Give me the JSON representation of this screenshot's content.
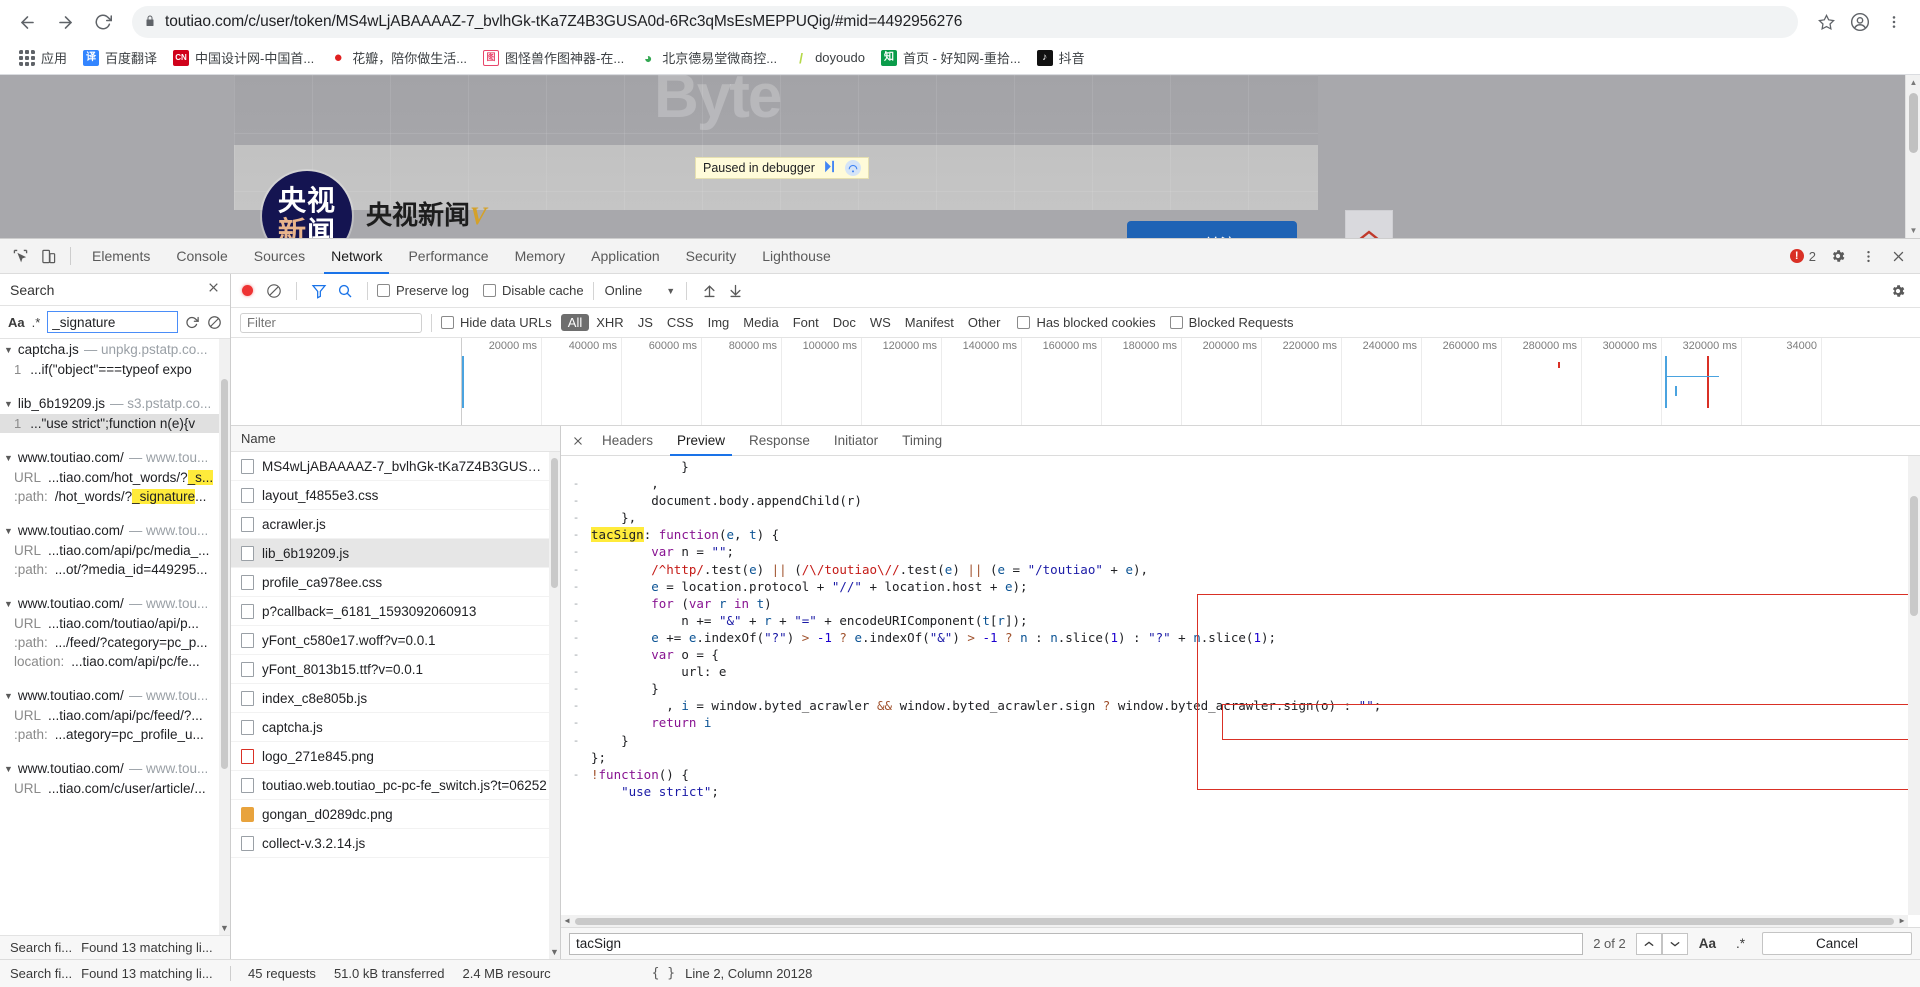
{
  "browser": {
    "url": "toutiao.com/c/user/token/MS4wLjABAAAAZ-7_bvlhGk-tKa7Z4B3GUSA0d-6Rc3qMsEsMEPPUQig/#mid=4492956276",
    "back_icon": "back-arrow-icon",
    "forward_icon": "forward-arrow-icon",
    "reload_icon": "reload-icon",
    "lock_icon": "lock-icon",
    "star_icon": "star-icon",
    "profile_icon": "profile-avatar-icon",
    "menu_icon": "three-dot-menu-icon",
    "bookmarks": [
      {
        "label": "应用",
        "icon": "apps-grid-icon",
        "color": "#4285f4",
        "glyph": ""
      },
      {
        "label": "百度翻译",
        "icon": "baidu-translate-icon",
        "color": "#3385ff",
        "glyph": "译"
      },
      {
        "label": "中国设计网-中国首...",
        "icon": "cnd-icon",
        "color": "#d0021b",
        "glyph": "CN"
      },
      {
        "label": "花瓣，陪你做生活...",
        "icon": "huaban-icon",
        "color": "#e02020",
        "glyph": "●"
      },
      {
        "label": "图怪兽作图神器-在...",
        "icon": "tuguaishou-icon",
        "color": "#e8466b",
        "glyph": "图"
      },
      {
        "label": "北京德易堂微商控...",
        "icon": "deyitang-icon",
        "color": "#34a853",
        "glyph": "◎"
      },
      {
        "label": "doyoudo",
        "icon": "doyoudo-icon",
        "color": "#c9e265",
        "glyph": "/"
      },
      {
        "label": "首页 - 好知网-重拾...",
        "icon": "haozhi-icon",
        "color": "#0a9c4a",
        "glyph": "知"
      },
      {
        "label": "抖音",
        "icon": "douyin-icon",
        "color": "#111111",
        "glyph": "♪"
      }
    ]
  },
  "page": {
    "watermark": "Byte",
    "avatar_line1": "央视",
    "avatar_line2_a": "新",
    "avatar_line2_b": "闻",
    "account_name": "央视新闻",
    "account_badge": "V",
    "follow_label": "＋关注",
    "scroll_top_icon": "chevron-up-icon",
    "paused_banner": {
      "text": "Paused in debugger",
      "resume_icon": "resume-script-icon",
      "step_icon": "step-over-icon"
    }
  },
  "devtools": {
    "inspect_icon": "inspect-element-icon",
    "device_icon": "device-toolbar-icon",
    "tabs": [
      {
        "label": "Elements",
        "active": false
      },
      {
        "label": "Console",
        "active": false
      },
      {
        "label": "Sources",
        "active": false
      },
      {
        "label": "Network",
        "active": true
      },
      {
        "label": "Performance",
        "active": false
      },
      {
        "label": "Memory",
        "active": false
      },
      {
        "label": "Application",
        "active": false
      },
      {
        "label": "Security",
        "active": false
      },
      {
        "label": "Lighthouse",
        "active": false
      }
    ],
    "error_count": "2",
    "settings_icon": "gear-icon",
    "more_icon": "three-dot-menu-icon",
    "close_icon": "close-icon",
    "customize_icon": "customize-settings-icon"
  },
  "search_panel": {
    "title": "Search",
    "close_icon": "close-icon",
    "match_case_label": "Aa",
    "regex_label": ".*",
    "query": "_signature",
    "refresh_icon": "refresh-icon",
    "clear_icon": "clear-icon",
    "footer_label": "Search fi...",
    "footer_result": "Found 13 matching li...",
    "results": [
      {
        "file": "captcha.js",
        "origin": "— unpkg.pstatp.co...",
        "lines": [
          {
            "num": "1",
            "text": "...if(\"object\"===typeof expo",
            "tail": "...",
            "selected": false
          }
        ]
      },
      {
        "file": "lib_6b19209.js",
        "origin": "— s3.pstatp.co...",
        "lines": [
          {
            "num": "1",
            "text": "...\"use strict\";function n(e){v",
            "tail": "...",
            "selected": true
          }
        ]
      },
      {
        "file": "www.toutiao.com/",
        "origin": "— www.tou...",
        "kvs": [
          {
            "key": "URL",
            "pre": "...tiao.com/hot_words/?",
            "hl": "_s...",
            "post": ""
          },
          {
            "key": ":path:",
            "pre": "/hot_words/?",
            "hl": "_signature",
            "post": "..."
          }
        ]
      },
      {
        "file": "www.toutiao.com/",
        "origin": "— www.tou...",
        "kvs": [
          {
            "key": "URL",
            "pre": "...tiao.com/api/pc/media_...",
            "hl": "",
            "post": ""
          },
          {
            "key": ":path:",
            "pre": "...ot/?media_id=449295...",
            "hl": "",
            "post": ""
          }
        ]
      },
      {
        "file": "www.toutiao.com/",
        "origin": "— www.tou...",
        "kvs": [
          {
            "key": "URL",
            "pre": "...tiao.com/toutiao/api/p...",
            "hl": "",
            "post": ""
          },
          {
            "key": ":path:",
            "pre": ".../feed/?category=pc_p...",
            "hl": "",
            "post": ""
          },
          {
            "key": "location:",
            "pre": "...tiao.com/api/pc/fe...",
            "hl": "",
            "post": ""
          }
        ]
      },
      {
        "file": "www.toutiao.com/",
        "origin": "— www.tou...",
        "kvs": [
          {
            "key": "URL",
            "pre": "...tiao.com/api/pc/feed/?...",
            "hl": "",
            "post": ""
          },
          {
            "key": ":path:",
            "pre": "...ategory=pc_profile_u...",
            "hl": "",
            "post": ""
          }
        ]
      },
      {
        "file": "www.toutiao.com/",
        "origin": "— www.tou...",
        "kvs": [
          {
            "key": "URL",
            "pre": "...tiao.com/c/user/article/...",
            "hl": "",
            "post": ""
          }
        ]
      }
    ]
  },
  "network": {
    "record_icon": "record-button-icon",
    "clear_icon": "clear-network-icon",
    "filter_icon": "filter-funnel-icon",
    "search_icon": "search-icon",
    "preserve_log_label": "Preserve log",
    "disable_cache_label": "Disable cache",
    "throttling_value": "Online",
    "import_icon": "import-har-icon",
    "export_icon": "export-har-icon",
    "filter_placeholder": "Filter",
    "hide_data_urls_label": "Hide data URLs",
    "type_chips": [
      {
        "label": "All",
        "active": true
      },
      {
        "label": "XHR",
        "active": false
      },
      {
        "label": "JS",
        "active": false
      },
      {
        "label": "CSS",
        "active": false
      },
      {
        "label": "Img",
        "active": false
      },
      {
        "label": "Media",
        "active": false
      },
      {
        "label": "Font",
        "active": false
      },
      {
        "label": "Doc",
        "active": false
      },
      {
        "label": "WS",
        "active": false
      },
      {
        "label": "Manifest",
        "active": false
      },
      {
        "label": "Other",
        "active": false
      }
    ],
    "has_blocked_cookies_label": "Has blocked cookies",
    "blocked_requests_label": "Blocked Requests",
    "timeline_ticks": [
      "20000 ms",
      "40000 ms",
      "60000 ms",
      "80000 ms",
      "100000 ms",
      "120000 ms",
      "140000 ms",
      "160000 ms",
      "180000 ms",
      "200000 ms",
      "220000 ms",
      "240000 ms",
      "260000 ms",
      "280000 ms",
      "300000 ms",
      "320000 ms",
      "34000"
    ],
    "name_column_header": "Name",
    "requests": [
      {
        "name": "MS4wLjABAAAAZ-7_bvlhGk-tKa7Z4B3GUSA0d-.",
        "icon": "document-icon",
        "selected": false
      },
      {
        "name": "layout_f4855e3.css",
        "icon": "stylesheet-icon",
        "selected": false
      },
      {
        "name": "acrawler.js",
        "icon": "script-icon",
        "selected": false
      },
      {
        "name": "lib_6b19209.js",
        "icon": "script-icon",
        "selected": true
      },
      {
        "name": "profile_ca978ee.css",
        "icon": "stylesheet-icon",
        "selected": false
      },
      {
        "name": "p?callback=_6181_1593092060913",
        "icon": "script-icon",
        "selected": false
      },
      {
        "name": "yFont_c580e17.woff?v=0.0.1",
        "icon": "font-icon",
        "selected": false
      },
      {
        "name": "yFont_8013b15.ttf?v=0.0.1",
        "icon": "font-icon",
        "selected": false
      },
      {
        "name": "index_c8e805b.js",
        "icon": "script-icon",
        "selected": false
      },
      {
        "name": "captcha.js",
        "icon": "script-icon",
        "selected": false
      },
      {
        "name": "logo_271e845.png",
        "icon": "image-icon",
        "selected": false
      },
      {
        "name": "toutiao.web.toutiao_pc-pc-fe_switch.js?t=06252",
        "icon": "script-icon",
        "selected": false
      },
      {
        "name": "gongan_d0289dc.png",
        "icon": "image-png-icon",
        "selected": false
      },
      {
        "name": "collect-v.3.2.14.js",
        "icon": "script-icon",
        "selected": false
      }
    ],
    "detail_tabs": [
      {
        "label": "Headers",
        "active": false
      },
      {
        "label": "Preview",
        "active": true
      },
      {
        "label": "Response",
        "active": false
      },
      {
        "label": "Initiator",
        "active": false
      },
      {
        "label": "Timing",
        "active": false
      }
    ],
    "detail_close_icon": "close-icon",
    "code_lines": [
      {
        "fold": "",
        "text": "            }"
      },
      {
        "fold": "-",
        "text": "        ,"
      },
      {
        "fold": "-",
        "text": "        document.body.appendChild(r)"
      },
      {
        "fold": "-",
        "text": "    },"
      },
      {
        "fold": "-",
        "text": "    tacSign: function(e, t) {"
      },
      {
        "fold": "-",
        "text": "        var n = \"\";"
      },
      {
        "fold": "-",
        "text": "        /^http/.test(e) || (/\\/toutiao\\//.test(e) || (e = \"/toutiao\" + e),"
      },
      {
        "fold": "-",
        "text": "        e = location.protocol + \"//\" + location.host + e);"
      },
      {
        "fold": "-",
        "text": "        for (var r in t)"
      },
      {
        "fold": "-",
        "text": "            n += \"&\" + r + \"=\" + encodeURIComponent(t[r]);"
      },
      {
        "fold": "-",
        "text": "        e += e.indexOf(\"?\") > -1 ? e.indexOf(\"&\") > -1 ? n : n.slice(1) : \"?\" + n.slice(1);"
      },
      {
        "fold": "-",
        "text": "        var o = {"
      },
      {
        "fold": "-",
        "text": "            url: e"
      },
      {
        "fold": "-",
        "text": "        }"
      },
      {
        "fold": "-",
        "text": "          , i = window.byted_acrawler && window.byted_acrawler.sign ? window.byted_acrawler.sign(o) : \"\";"
      },
      {
        "fold": "-",
        "text": "        return i"
      },
      {
        "fold": "-",
        "text": "    }"
      },
      {
        "fold": "",
        "text": "};"
      },
      {
        "fold": "-",
        "text": "!function() {"
      },
      {
        "fold": "",
        "text": "    \"use strict\";"
      }
    ],
    "find": {
      "query": "tacSign",
      "count": "2 of 2",
      "prev_icon": "chevron-up-icon",
      "next_icon": "chevron-down-icon",
      "match_case_label": "Aa",
      "regex_label": ".*",
      "cancel_label": "Cancel"
    },
    "status": {
      "requests": "45 requests",
      "transferred": "51.0 kB transferred",
      "resources": "2.4 MB resourc",
      "cursor_position": "Line 2, Column 20128",
      "format_icon": "pretty-print-icon"
    }
  }
}
